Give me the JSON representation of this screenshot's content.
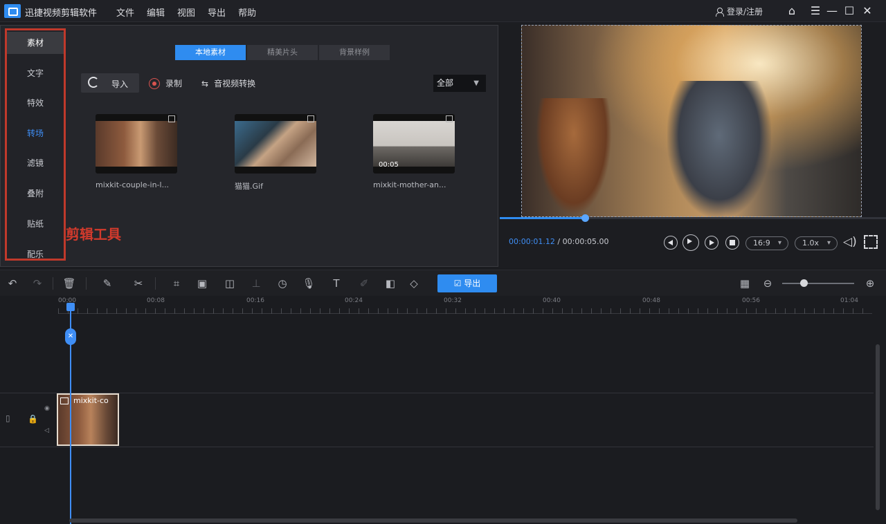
{
  "titlebar": {
    "app_name": "迅捷视频剪辑软件",
    "menu": [
      "文件",
      "编辑",
      "视图",
      "导出",
      "帮助"
    ],
    "login": "登录/注册",
    "home_icon": "home-icon",
    "menu_icon": "hamburger-icon",
    "minimize_icon": "minimize-icon",
    "maximize_icon": "maximize-icon",
    "close_icon": "close-icon"
  },
  "sidebar": {
    "items": [
      {
        "label": "素材",
        "state": "active"
      },
      {
        "label": "文字"
      },
      {
        "label": "特效"
      },
      {
        "label": "转场",
        "state": "highlight"
      },
      {
        "label": "滤镜"
      },
      {
        "label": "叠附"
      },
      {
        "label": "贴纸"
      },
      {
        "label": "配乐"
      }
    ],
    "annotation": "剪辑工具",
    "annotation_color": "#d33a2c"
  },
  "media_panel": {
    "tabs": [
      {
        "label": "本地素材",
        "active": true
      },
      {
        "label": "精美片头"
      },
      {
        "label": "背景样例"
      }
    ],
    "import_label": "导入",
    "record_label": "录制",
    "convert_label": "音视频转换",
    "filter": {
      "value": "全部"
    },
    "items": [
      {
        "caption": "mixkit-couple-in-l..."
      },
      {
        "caption": "猫猫.Gif"
      },
      {
        "caption": "mixkit-mother-an...",
        "duration": "00:05"
      }
    ]
  },
  "preview": {
    "current_time": "00:00:01.12",
    "separator": "/",
    "total_time": "00:00:05.00",
    "progress": 0.22,
    "aspect": "16:9",
    "speed": "1.0x"
  },
  "toolbar": {
    "export_label": "导出",
    "zoom_level": 0.3
  },
  "timeline": {
    "ruler_labels": [
      "00:00",
      "00:08",
      "00:16",
      "00:24",
      "00:32",
      "00:40",
      "00:48",
      "00:56",
      "01:04"
    ],
    "clip_label": "mixkit-co"
  },
  "colors": {
    "accent": "#2f8cf0",
    "background": "#1b1c20",
    "panel": "#25262b"
  }
}
